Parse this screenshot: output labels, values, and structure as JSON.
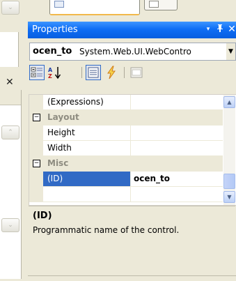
{
  "panel": {
    "title": "Properties",
    "title_buttons": {
      "dropdown": "▾",
      "pin": "ᵖ",
      "close": "✕"
    }
  },
  "object_selector": {
    "name": "ocen_to",
    "type": "System.Web.UI.WebContro"
  },
  "toolbar": {
    "items": [
      "categorized-icon",
      "alphabetical-icon",
      "properties-icon",
      "events-icon",
      "property-pages-icon"
    ]
  },
  "grid": {
    "rows": [
      {
        "kind": "property",
        "name": "(Expressions)",
        "value": ""
      },
      {
        "kind": "category",
        "name": "Layout",
        "expander": "−"
      },
      {
        "kind": "property",
        "name": "Height",
        "value": ""
      },
      {
        "kind": "property",
        "name": "Width",
        "value": ""
      },
      {
        "kind": "category",
        "name": "Misc",
        "expander": "−"
      },
      {
        "kind": "property",
        "name": "(ID)",
        "value": "ocen_to",
        "selected": true
      }
    ]
  },
  "description": {
    "title": "(ID)",
    "text": "Programmatic name of the control."
  },
  "side": {
    "close_glyph": "✕"
  },
  "colors": {
    "titlebar": "#0f6ef5",
    "selection": "#316ac5",
    "chrome": "#ece9d8"
  }
}
